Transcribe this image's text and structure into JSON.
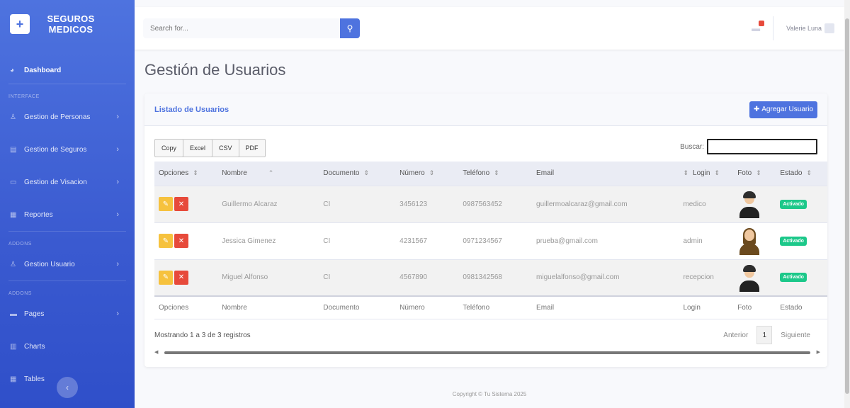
{
  "brand": {
    "line1": "SEGUROS",
    "line2": "MEDICOS",
    "icon": "briefcase-medical-icon"
  },
  "sidebar": {
    "dashboard": "Dashboard",
    "heading_interface": "INTERFACE",
    "items": [
      {
        "label": "Gestion de Personas"
      },
      {
        "label": "Gestion de Seguros"
      },
      {
        "label": "Gestion de Visacion"
      },
      {
        "label": "Reportes"
      }
    ],
    "heading_addons1": "ADDONS",
    "users": "Gestion Usuario",
    "heading_addons2": "ADDONS",
    "pages": "Pages",
    "charts": "Charts",
    "tables": "Tables"
  },
  "topbar": {
    "search_placeholder": "Search for...",
    "user_name": "Valerie Luna"
  },
  "page_title": "Gestión de Usuarios",
  "card": {
    "title": "Listado de Usuarios",
    "add_label": "Agregar Usuario"
  },
  "buttons": {
    "copy": "Copy",
    "excel": "Excel",
    "csv": "CSV",
    "pdf": "PDF"
  },
  "search_label": "Buscar:",
  "columns": [
    "Opciones",
    "Nombre",
    "Documento",
    "Número",
    "Teléfono",
    "Email",
    "Login",
    "Foto",
    "Estado"
  ],
  "rows": [
    {
      "nombre": "Guillermo Alcaraz",
      "documento": "CI",
      "numero": "3456123",
      "telefono": "0987563452",
      "email": "guillermoalcaraz@gmail.com",
      "login": "medico",
      "estado": "Activado"
    },
    {
      "nombre": "Jessica Gimenez",
      "documento": "CI",
      "numero": "4231567",
      "telefono": "0971234567",
      "email": "prueba@gmail.com",
      "login": "admin",
      "estado": "Activado"
    },
    {
      "nombre": "Miguel Alfonso",
      "documento": "CI",
      "numero": "4567890",
      "telefono": "0981342568",
      "email": "miguelalfonso@gmail.com",
      "login": "recepcion",
      "estado": "Activado"
    }
  ],
  "info": "Mostrando 1 a 3 de 3 registros",
  "pager": {
    "prev": "Anterior",
    "current": "1",
    "next": "Siguiente"
  },
  "footer": "Copyright © Tu Sistema 2025",
  "colors": {
    "primary": "#4e73df",
    "edit": "#f6c23e",
    "delete": "#e74a3b",
    "success": "#1cc88a"
  }
}
